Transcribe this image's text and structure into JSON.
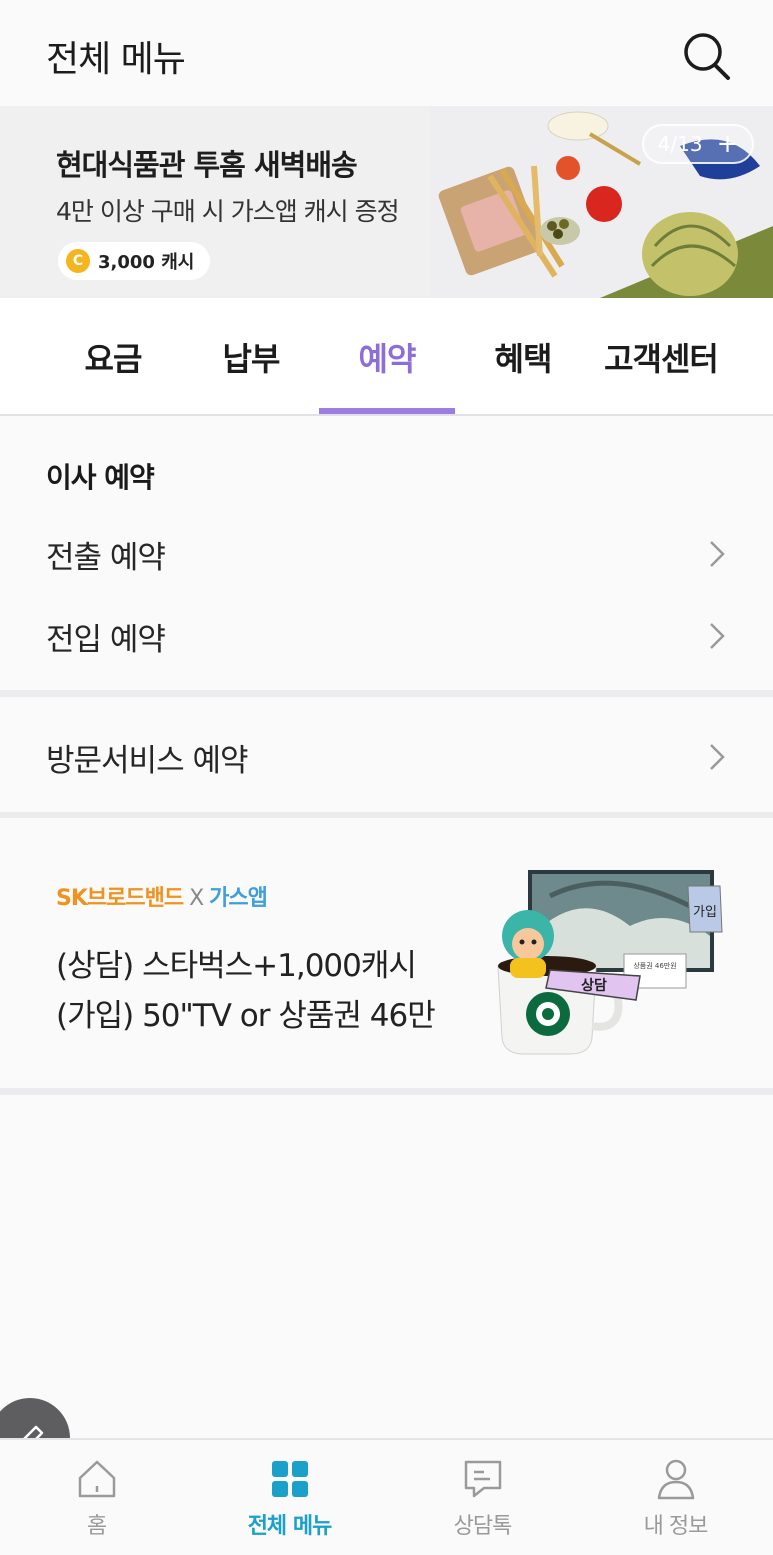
{
  "header": {
    "title": "전체 메뉴",
    "search_icon": "search-icon"
  },
  "banner": {
    "title": "현대식품관 투홈 새벽배송",
    "subtitle": "4만 이상 구매 시 가스앱 캐시 증정",
    "chip_coin": "C",
    "chip_text": "3,000 캐시",
    "counter": "4/13",
    "counter_plus": "+"
  },
  "tabs": [
    {
      "label": "요금",
      "active": false
    },
    {
      "label": "납부",
      "active": false
    },
    {
      "label": "예약",
      "active": true
    },
    {
      "label": "혜택",
      "active": false
    },
    {
      "label": "고객센터",
      "active": false
    }
  ],
  "reservation": {
    "heading": "이사 예약",
    "items": [
      {
        "label": "전출 예약"
      },
      {
        "label": "전입 예약"
      }
    ],
    "visit_item": {
      "label": "방문서비스 예약"
    }
  },
  "promo": {
    "brand_sk": "SK브로드밴드",
    "brand_x": "X",
    "brand_gas": "가스앱",
    "line1": "(상담) 스타벅스+1,000캐시",
    "line2": "(가입) 50\"TV or 상품권 46만",
    "tag_join": "가입",
    "tag_consult": "상담",
    "voucher": "상품권 46만원"
  },
  "bottom_nav": [
    {
      "label": "홈",
      "icon": "home-icon",
      "active": false
    },
    {
      "label": "전체 메뉴",
      "icon": "grid-menu-icon",
      "active": true
    },
    {
      "label": "상담톡",
      "icon": "chat-icon",
      "active": false
    },
    {
      "label": "내 정보",
      "icon": "person-icon",
      "active": false
    }
  ],
  "colors": {
    "accent_purple": "#8d6ed8",
    "nav_active": "#1aa0c9",
    "coin": "#f6b51e"
  }
}
